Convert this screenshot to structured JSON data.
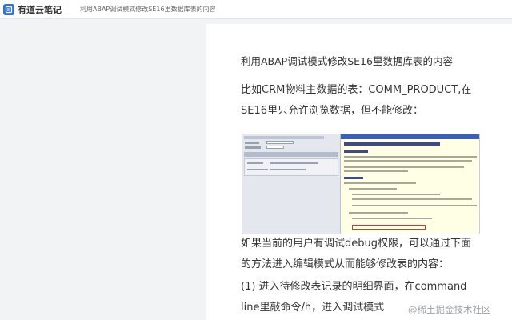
{
  "app": {
    "name": "有道云笔记",
    "logo_icon": "youdao-note-logo-icon",
    "brand_color": "#2f6ee8"
  },
  "tab": {
    "title": "利用ABAP调试模式修改SE16里数据库表的内容"
  },
  "note": {
    "title": "利用ABAP调试模式修改SE16里数据库表的内容",
    "paragraphs": [
      "比如CRM物料主数据的表：COMM_PRODUCT,在SE16里只允许浏览数据，但不能修改：",
      "如果当前的用户有调试debug权限，可以通过下面的方法进入编辑模式从而能够修改表的内容：",
      "(1) 进入待修改表记录的明细界面，在command line里敲命令/h，进入调试模式"
    ],
    "image": {
      "icon": "sap-screenshot-image",
      "highlight_color": "#dd3333"
    }
  },
  "watermark": {
    "text": "@稀土掘金技术社区"
  }
}
